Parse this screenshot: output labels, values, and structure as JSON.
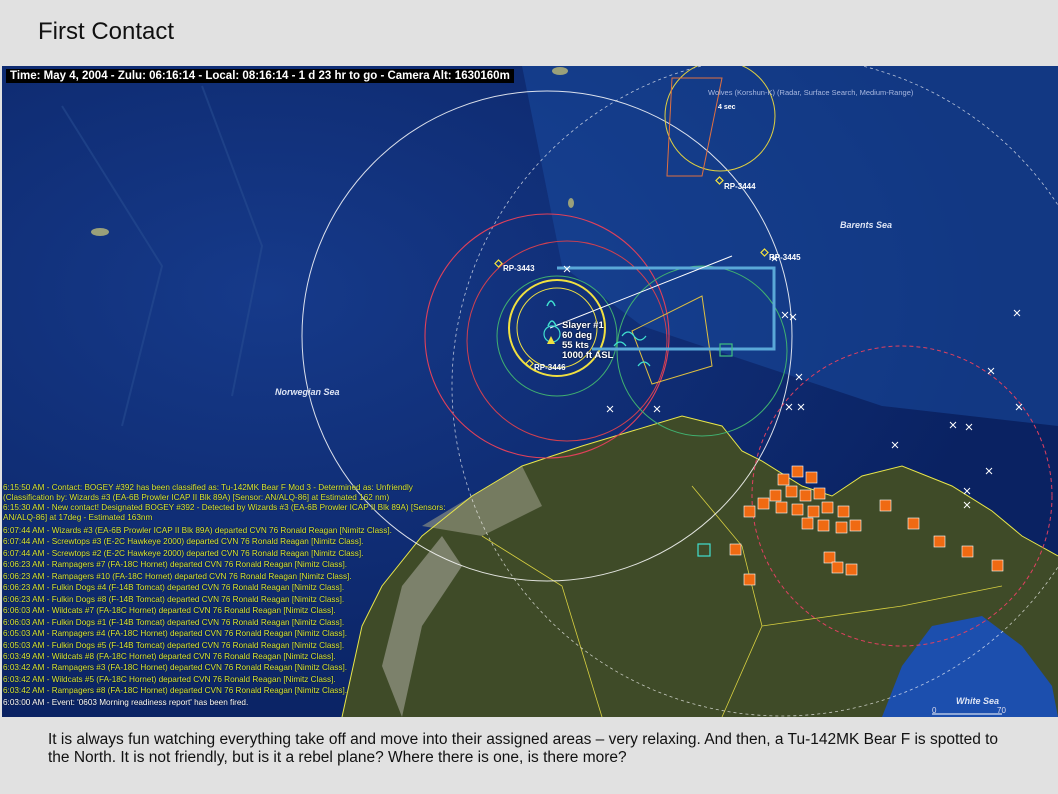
{
  "slide": {
    "title": "First Contact",
    "caption": "It is always fun watching everything take off and move into their assigned areas – very relaxing.  And then, a Tu-142MK Bear F is spotted to the North.  It is not friendly, but is it a rebel plane?  Where there is one, is there more?"
  },
  "map": {
    "status_bar": "Time: May 4, 2004 - Zulu: 06:16:14 - Local: 08:16:14 - 1 d 23 hr to go -  Camera Alt: 1630160m",
    "sea_labels": {
      "barents": "Barents Sea",
      "norwegian": "Norwegian Sea",
      "white": "White Sea"
    },
    "reference_points": {
      "rp3444": "RP-3444",
      "rp3445": "RP-3445",
      "rp3443": "RP-3443",
      "rp3446": "RP-3446"
    },
    "radar_label": "Wolves (Korshun-K) (Radar, Surface Search, Medium-Range)",
    "radar_time": "4 sec",
    "unit": {
      "name": "Slayer #1",
      "heading": "60 deg",
      "speed": "55 kts",
      "altitude": "1000 ft ASL"
    },
    "scale": {
      "zero": "0",
      "seventy": "70"
    },
    "colors": {
      "ocean": "#0d2a6e",
      "land": "#3f4b28",
      "route": "#5aa8d8",
      "log_text": "#d8e83a",
      "base_marker": "#f06a12"
    }
  },
  "message_log": [
    "6:15:50 AM - Contact: BOGEY #392 has been classified as: Tu-142MK Bear F Mod 3 - Determined as: Unfriendly (Classification by: Wizards #3 (EA-6B Prowler ICAP II Blk 89A) [Sensor: AN/ALQ-86] at Estimated 162 nm)",
    "6:15:30 AM - New contact! Designated BOGEY #392 - Detected by Wizards #3 (EA-6B Prowler ICAP II Blk 89A) [Sensors: AN/ALQ-86] at 17deg - Estimated 163nm",
    "6:07:44 AM - Wizards #3 (EA-6B Prowler ICAP II Blk 89A) departed CVN 76 Ronald Reagan [Nimitz Class].",
    "6:07:44 AM - Screwtops #3 (E-2C Hawkeye 2000) departed CVN 76 Ronald Reagan [Nimitz Class].",
    "6:07:44 AM - Screwtops #2 (E-2C Hawkeye 2000) departed CVN 76 Ronald Reagan [Nimitz Class].",
    "6:06:23 AM - Rampagers #7 (FA-18C Hornet) departed CVN 76 Ronald Reagan [Nimitz Class].",
    "6:06:23 AM - Rampagers #10 (FA-18C Hornet) departed CVN 76 Ronald Reagan [Nimitz Class].",
    "6:06:23 AM - Fulkin Dogs #4 (F-14B Tomcat) departed CVN 76 Ronald Reagan [Nimitz Class].",
    "6:06:23 AM - Fulkin Dogs #8 (F-14B Tomcat) departed CVN 76 Ronald Reagan [Nimitz Class].",
    "6:06:03 AM - Wildcats #7 (FA-18C Hornet) departed CVN 76 Ronald Reagan [Nimitz Class].",
    "6:06:03 AM - Fulkin Dogs #1 (F-14B Tomcat) departed CVN 76 Ronald Reagan [Nimitz Class].",
    "6:05:03 AM - Rampagers #4 (FA-18C Hornet) departed CVN 76 Ronald Reagan [Nimitz Class].",
    "6:05:03 AM - Fulkin Dogs #5 (F-14B Tomcat) departed CVN 76 Ronald Reagan [Nimitz Class].",
    "6:03:49 AM - Wildcats #8 (FA-18C Hornet) departed CVN 76 Ronald Reagan [Nimitz Class].",
    "6:03:42 AM - Rampagers #3 (FA-18C Hornet) departed CVN 76 Ronald Reagan [Nimitz Class].",
    "6:03:42 AM - Wildcats #5 (FA-18C Hornet) departed CVN 76 Ronald Reagan [Nimitz Class].",
    "6:03:42 AM - Rampagers #8 (FA-18C Hornet) departed CVN 76 Ronald Reagan [Nimitz Class].",
    "6:03:00 AM - Event: '0603 Morning readiness report' has been fired."
  ]
}
